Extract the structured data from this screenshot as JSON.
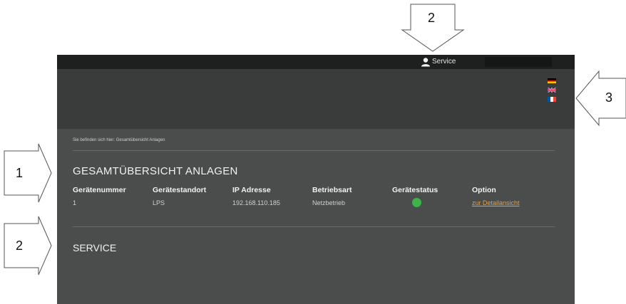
{
  "callouts": {
    "n1": "1",
    "n2_top": "2",
    "n2_left": "2",
    "n3": "3"
  },
  "topbar": {
    "service_label": "Service",
    "icon": "user-icon"
  },
  "languages": [
    {
      "name": "de-flag-icon"
    },
    {
      "name": "en-flag-icon"
    },
    {
      "name": "fr-flag-icon"
    }
  ],
  "breadcrumb": "Sie befinden sich hier: Gesamtübersicht Anlagen",
  "overview": {
    "title": "GESAMTÜBERSICHT ANLAGEN",
    "headers": [
      "Gerätenummer",
      "Gerätestandort",
      "IP Adresse",
      "Betriebsart",
      "Gerätestatus",
      "Option"
    ],
    "row": {
      "nummer": "1",
      "standort": "LPS",
      "ip": "192.168.110.185",
      "betriebsart": "Netzbetrieb",
      "status_color": "#3eb44a",
      "option_link": "zur Detailansicht"
    }
  },
  "service_section": {
    "title": "SERVICE"
  },
  "colors": {
    "accent": "#e3a23f",
    "status_ok": "#3eb44a"
  }
}
